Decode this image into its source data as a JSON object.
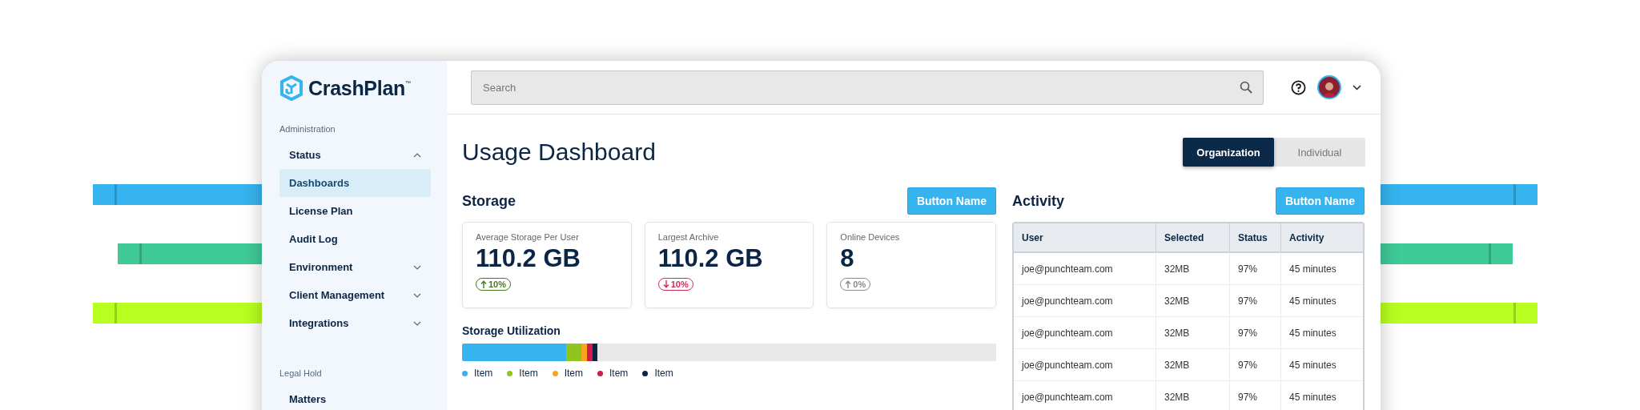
{
  "logo": {
    "text": "CrashPlan",
    "mark": "™"
  },
  "sidebar": {
    "sections": [
      {
        "title": "Administration",
        "items": [
          {
            "label": "Status",
            "expanded": true,
            "children": [
              {
                "label": "Dashboards",
                "selected": true
              },
              {
                "label": "License Plan",
                "selected": false
              },
              {
                "label": "Audit Log",
                "selected": false
              }
            ]
          },
          {
            "label": "Environment",
            "expanded": false
          },
          {
            "label": "Client Management",
            "expanded": false
          },
          {
            "label": "Integrations",
            "expanded": false
          }
        ]
      },
      {
        "title": "Legal Hold",
        "items": [
          {
            "label": "Matters"
          }
        ]
      }
    ]
  },
  "search": {
    "placeholder": "Search"
  },
  "page_title": "Usage Dashboard",
  "view_toggle": [
    {
      "label": "Organization",
      "selected": true
    },
    {
      "label": "Individual",
      "selected": false
    }
  ],
  "storage": {
    "title": "Storage",
    "button": "Button Name",
    "cards": [
      {
        "label": "Average Storage Per User",
        "value": "110.2 GB",
        "change": "10%",
        "kind": "up",
        "color": "#4a7a1c"
      },
      {
        "label": "Largest Archive",
        "value": "110.2 GB",
        "change": "10%",
        "kind": "down",
        "color": "#d62b55"
      },
      {
        "label": "Online Devices",
        "value": "8",
        "change": "0%",
        "kind": "up",
        "color": "#8a8a8a"
      }
    ],
    "utilization": {
      "title": "Storage Utilization",
      "legend": [
        {
          "label": "Item",
          "color": "#35b4ef"
        },
        {
          "label": "Item",
          "color": "#8fc51d"
        },
        {
          "label": "Item",
          "color": "#f7a522"
        },
        {
          "label": "Item",
          "color": "#d31b4c"
        },
        {
          "label": "Item",
          "color": "#0b2545"
        }
      ]
    }
  },
  "activity": {
    "title": "Activity",
    "button": "Button Name",
    "columns": [
      "User",
      "Selected",
      "Status",
      "Activity"
    ],
    "rows": [
      [
        "joe@punchteam.com",
        "32MB",
        "97%",
        "45 minutes"
      ],
      [
        "joe@punchteam.com",
        "32MB",
        "97%",
        "45 minutes"
      ],
      [
        "joe@punchteam.com",
        "32MB",
        "97%",
        "45 minutes"
      ],
      [
        "joe@punchteam.com",
        "32MB",
        "97%",
        "45 minutes"
      ],
      [
        "joe@punchteam.com",
        "32MB",
        "97%",
        "45 minutes"
      ]
    ]
  }
}
